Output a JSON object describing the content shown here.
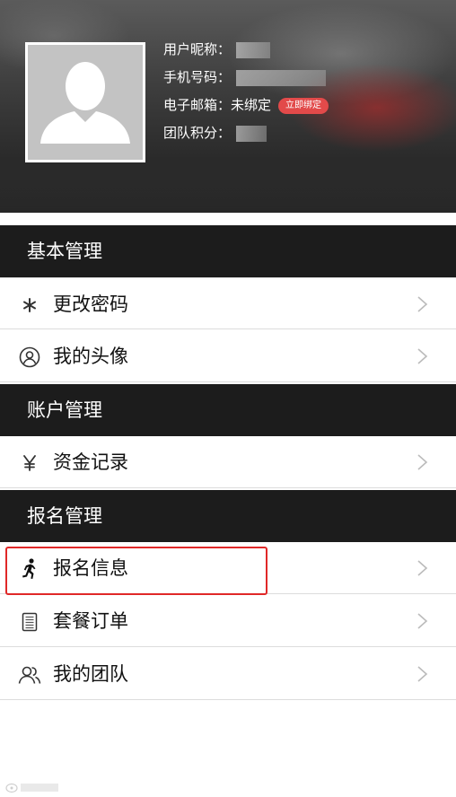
{
  "profile": {
    "nickname_label": "用户昵称：",
    "phone_label": "手机号码：",
    "email_label": "电子邮箱：",
    "email_value": "未绑定",
    "bind_button": "立即绑定",
    "points_label": "团队积分："
  },
  "sections": [
    {
      "title": "基本管理",
      "items": [
        {
          "label": "更改密码",
          "icon": "asterisk-icon"
        },
        {
          "label": "我的头像",
          "icon": "user-circle-icon"
        }
      ]
    },
    {
      "title": "账户管理",
      "items": [
        {
          "label": "资金记录",
          "icon": "yen-icon"
        }
      ]
    },
    {
      "title": "报名管理",
      "items": [
        {
          "label": "报名信息",
          "icon": "runner-icon"
        },
        {
          "label": "套餐订单",
          "icon": "document-icon"
        },
        {
          "label": "我的团队",
          "icon": "team-icon"
        }
      ]
    }
  ],
  "colors": {
    "section_bg": "#1c1c1c",
    "bind_button_bg": "#e24a4a",
    "highlight_border": "#e02828"
  }
}
